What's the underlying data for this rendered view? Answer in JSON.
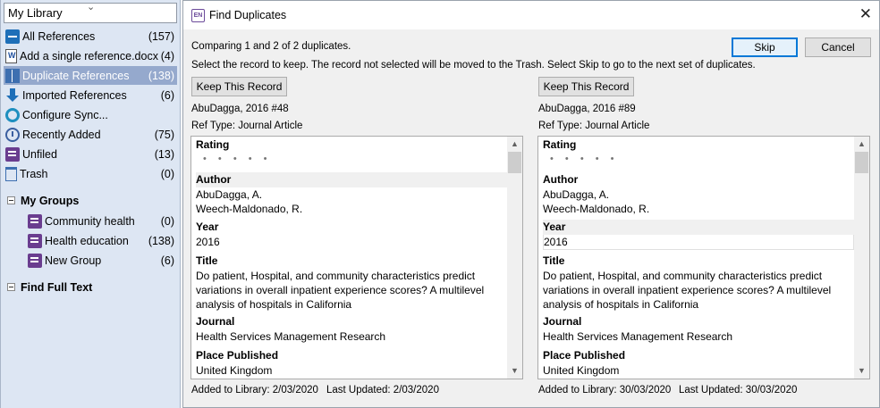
{
  "library": {
    "selector_label": "My Library",
    "items": [
      {
        "label": "All References",
        "count": "(157)"
      },
      {
        "label": "Add a single reference.docx",
        "count": "(4)"
      },
      {
        "label": "Duplicate References",
        "count": "(138)"
      },
      {
        "label": "Imported References",
        "count": "(6)"
      },
      {
        "label": "Configure Sync...",
        "count": ""
      },
      {
        "label": "Recently Added",
        "count": "(75)"
      },
      {
        "label": "Unfiled",
        "count": "(13)"
      },
      {
        "label": "Trash",
        "count": "(0)"
      }
    ],
    "groups_header": "My Groups",
    "groups": [
      {
        "label": "Community health",
        "count": "(0)"
      },
      {
        "label": "Health education",
        "count": "(138)"
      },
      {
        "label": "New Group",
        "count": "(6)"
      }
    ],
    "find_full_text": "Find Full Text"
  },
  "dialog": {
    "title": "Find Duplicates",
    "app_icon_text": "EN",
    "close_glyph": "✕",
    "comparing_text": "Comparing 1 and 2 of 2 duplicates.",
    "instruction_text": "Select the record to keep. The record not selected will be moved to the Trash. Select Skip to go to the next set of duplicates.",
    "skip_label": "Skip",
    "cancel_label": "Cancel",
    "records": [
      {
        "keep_label": "Keep This Record",
        "ref_id": "AbuDagga, 2016 #48",
        "ref_type": "Ref Type: Journal Article",
        "rating_label": "Rating",
        "rating_stars": "• • • • •",
        "author_label": "Author",
        "author_1": "AbuDagga, A.",
        "author_2": "Weech-Maldonado, R.",
        "year_label": "Year",
        "year": "2016",
        "title_label": "Title",
        "title_1": "Do patient, Hospital, and community characteristics predict",
        "title_2": "variations in overall inpatient experience scores? A multilevel",
        "title_3": "analysis of hospitals in California",
        "journal_label": "Journal",
        "journal": "Health Services Management Research",
        "place_label": "Place Published",
        "place": "United Kingdom",
        "added": "Added to Library: 2/03/2020",
        "updated": "Last Updated: 2/03/2020"
      },
      {
        "keep_label": "Keep This Record",
        "ref_id": "AbuDagga, 2016 #89",
        "ref_type": "Ref Type: Journal Article",
        "rating_label": "Rating",
        "rating_stars": "• • • • •",
        "author_label": "Author",
        "author_1": "AbuDagga, A.",
        "author_2": "Weech-Maldonado, R.",
        "year_label": "Year",
        "year": "2016",
        "title_label": "Title",
        "title_1": "Do patient, Hospital, and community characteristics predict",
        "title_2": "variations in overall inpatient experience scores? A multilevel",
        "title_3": "analysis of hospitals in California",
        "journal_label": "Journal",
        "journal": "Health Services Management Research",
        "place_label": "Place Published",
        "place": "United Kingdom",
        "added": "Added to Library: 30/03/2020",
        "updated": "Last Updated: 30/03/2020"
      }
    ]
  }
}
